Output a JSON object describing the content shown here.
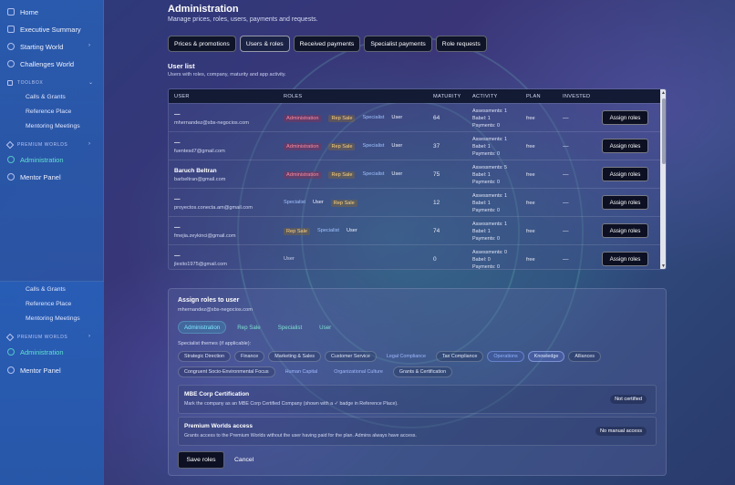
{
  "sidebar": {
    "top_items": [
      {
        "label": "Home",
        "icon": "home-icon"
      },
      {
        "label": "Executive Summary",
        "icon": "grid-icon"
      },
      {
        "label": "Starting World",
        "icon": "globe-icon"
      },
      {
        "label": "Challenges World",
        "icon": "badge-icon"
      }
    ],
    "toolbox_label": "TOOLBOX",
    "toolbox_items": [
      "Calls & Grants",
      "Reference Place",
      "Mentoring Meetings"
    ],
    "premium_label": "PREMIUM WORLDS",
    "admin_label": "Administration",
    "mentor_label": "Mentor Panel",
    "lower_toolbox_items": [
      "Calls & Grants",
      "Reference Place",
      "Mentoring Meetings"
    ],
    "lower_premium_label": "PREMIUM WORLDS",
    "lower_admin_label": "Administration",
    "lower_mentor_label": "Mentor Panel"
  },
  "header": {
    "title": "Administration",
    "subtitle": "Manage prices, roles, users, payments and requests."
  },
  "tabs": [
    {
      "label": "Prices & promotions",
      "active": false
    },
    {
      "label": "Users & roles",
      "active": true
    },
    {
      "label": "Received payments",
      "active": false
    },
    {
      "label": "Specialist payments",
      "active": false
    },
    {
      "label": "Role requests",
      "active": false
    }
  ],
  "user_list": {
    "title": "User list",
    "subtitle": "Users with roles, company, maturity and app activity.",
    "columns": [
      "USER",
      "ROLES",
      "MATURITY",
      "ACTIVITY",
      "PLAN",
      "INVESTED"
    ],
    "assign_label": "Assign roles",
    "rows": [
      {
        "name": "—",
        "email": "mhernandez@sbs-negocios.com",
        "roles": [
          "Administration",
          "Rep Sale",
          "Specialist",
          "User"
        ],
        "maturity": "64",
        "activity": [
          "Assessments: 1",
          "Babel: 1",
          "Payments: 0"
        ],
        "plan": "free",
        "invested": "—"
      },
      {
        "name": "—",
        "email": "fuentesd7@gmail.com",
        "roles": [
          "Administration",
          "Rep Sale",
          "Specialist",
          "User"
        ],
        "maturity": "37",
        "activity": [
          "Assessments: 1",
          "Babel: 1",
          "Payments: 0"
        ],
        "plan": "free",
        "invested": "—"
      },
      {
        "name": "Baruch Beltran",
        "email": "barbeltran@gmail.com",
        "roles": [
          "Administration",
          "Rep Sale",
          "Specialist",
          "User"
        ],
        "maturity": "75",
        "activity": [
          "Assessments: 5",
          "Babel: 1",
          "Payments: 0"
        ],
        "plan": "free",
        "invested": "—"
      },
      {
        "name": "—",
        "email": "proyectos.conecta.am@gmail.com",
        "roles": [
          "Specialist",
          "User",
          "Rep Sale"
        ],
        "maturity": "12",
        "activity": [
          "Assessments: 1",
          "Babel: 1",
          "Payments: 0"
        ],
        "plan": "free",
        "invested": "—"
      },
      {
        "name": "—",
        "email": "fmejia.zeykinci@gmail.com",
        "roles": [
          "Rep Sale",
          "Specialist",
          "User"
        ],
        "maturity": "74",
        "activity": [
          "Assessments: 1",
          "Babel: 1",
          "Payments: 0"
        ],
        "plan": "free",
        "invested": "—"
      },
      {
        "name": "—",
        "email": "jlexito1975@gmail.com",
        "roles": [
          "User"
        ],
        "maturity": "0",
        "activity": [
          "Assessments: 0",
          "Babel: 0",
          "Payments: 0"
        ],
        "plan": "free",
        "invested": "—"
      }
    ]
  },
  "assign_panel": {
    "title": "Assign roles to user",
    "email": "mhernandez@sbs-negocios.com",
    "role_chips": [
      {
        "label": "Administration",
        "on": true
      },
      {
        "label": "Rep Sale",
        "on": false
      },
      {
        "label": "Specialist",
        "on": false
      },
      {
        "label": "User",
        "on": false
      }
    ],
    "themes_label": "Specialist themes (if applicable):",
    "themes_row1": [
      {
        "label": "Strategic Direction",
        "state": "normal"
      },
      {
        "label": "Finance",
        "state": "normal"
      },
      {
        "label": "Marketing & Sales",
        "state": "normal"
      },
      {
        "label": "Customer Service",
        "state": "normal"
      },
      {
        "label": "Legal Compliance",
        "state": "flat"
      },
      {
        "label": "Tax Compliance",
        "state": "normal"
      },
      {
        "label": "Operations",
        "state": "on"
      },
      {
        "label": "Knowledge",
        "state": "sel"
      },
      {
        "label": "Alliances",
        "state": "normal"
      }
    ],
    "themes_row2": [
      {
        "label": "Congruent Socio-Environmental Focus",
        "state": "normal"
      },
      {
        "label": "Human Capital",
        "state": "flat"
      },
      {
        "label": "Organizational Culture",
        "state": "flat"
      },
      {
        "label": "Grants & Certification",
        "state": "normal"
      }
    ],
    "cert": {
      "title": "MBE Corp Certification",
      "desc": "Mark the company as an MBE Corp Certified Company (shown with a ✓ badge in Reference Place).",
      "status": "Not certified"
    },
    "premium": {
      "title": "Premium Worlds access",
      "desc": "Grants access to the Premium Worlds without the user having paid for the plan. Admins always have access.",
      "status": "No manual access"
    },
    "save_label": "Save roles",
    "cancel_label": "Cancel"
  }
}
